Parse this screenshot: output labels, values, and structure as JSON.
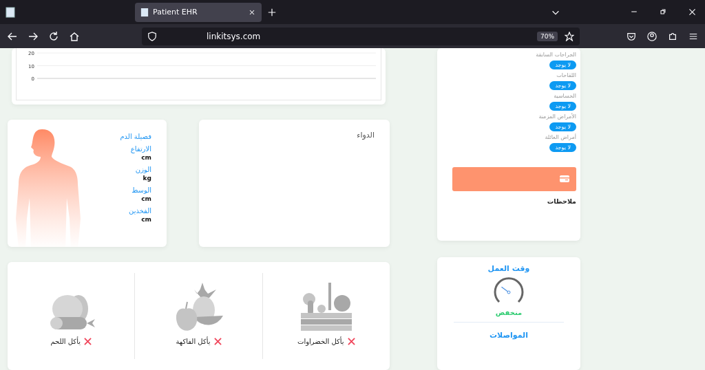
{
  "browser": {
    "tab_title": "Patient EHR",
    "url": "linkitsys.com",
    "zoom": "70%"
  },
  "chart": {
    "y_axis_labels": [
      "20",
      "10",
      "0"
    ]
  },
  "history": [
    {
      "label": "الجراحات السابقة",
      "value": "لا يوجد"
    },
    {
      "label": "اللقاحات",
      "value": "لا يوجد"
    },
    {
      "label": "الحساسية",
      "value": "لا يوجد"
    },
    {
      "label": "الأمراض المزمنة",
      "value": "لا يوجد"
    },
    {
      "label": "أمراض العائلة",
      "value": "لا يوجد"
    }
  ],
  "notes": {
    "title": "ملاحظات"
  },
  "body": {
    "blood_type_label": "فصيلة الدم",
    "measures": [
      {
        "label": "الارتفاع",
        "unit": "cm"
      },
      {
        "label": "الوزن",
        "unit": "kg"
      },
      {
        "label": "الوسط",
        "unit": "cm"
      },
      {
        "label": "الفخذين",
        "unit": "cm"
      }
    ]
  },
  "medicine": {
    "title": "الدواء"
  },
  "diet": [
    {
      "kind": "vegetables",
      "label": "يأكل الخضراوات",
      "checked": false
    },
    {
      "kind": "fruit",
      "label": "يأكل الفاكهة",
      "checked": false
    },
    {
      "kind": "meat",
      "label": "يأكل اللحم",
      "checked": false
    }
  ],
  "lifestyle": [
    {
      "title": "وقت العمل",
      "reading": "منخفض"
    },
    {
      "title": "المواصلات"
    }
  ]
}
